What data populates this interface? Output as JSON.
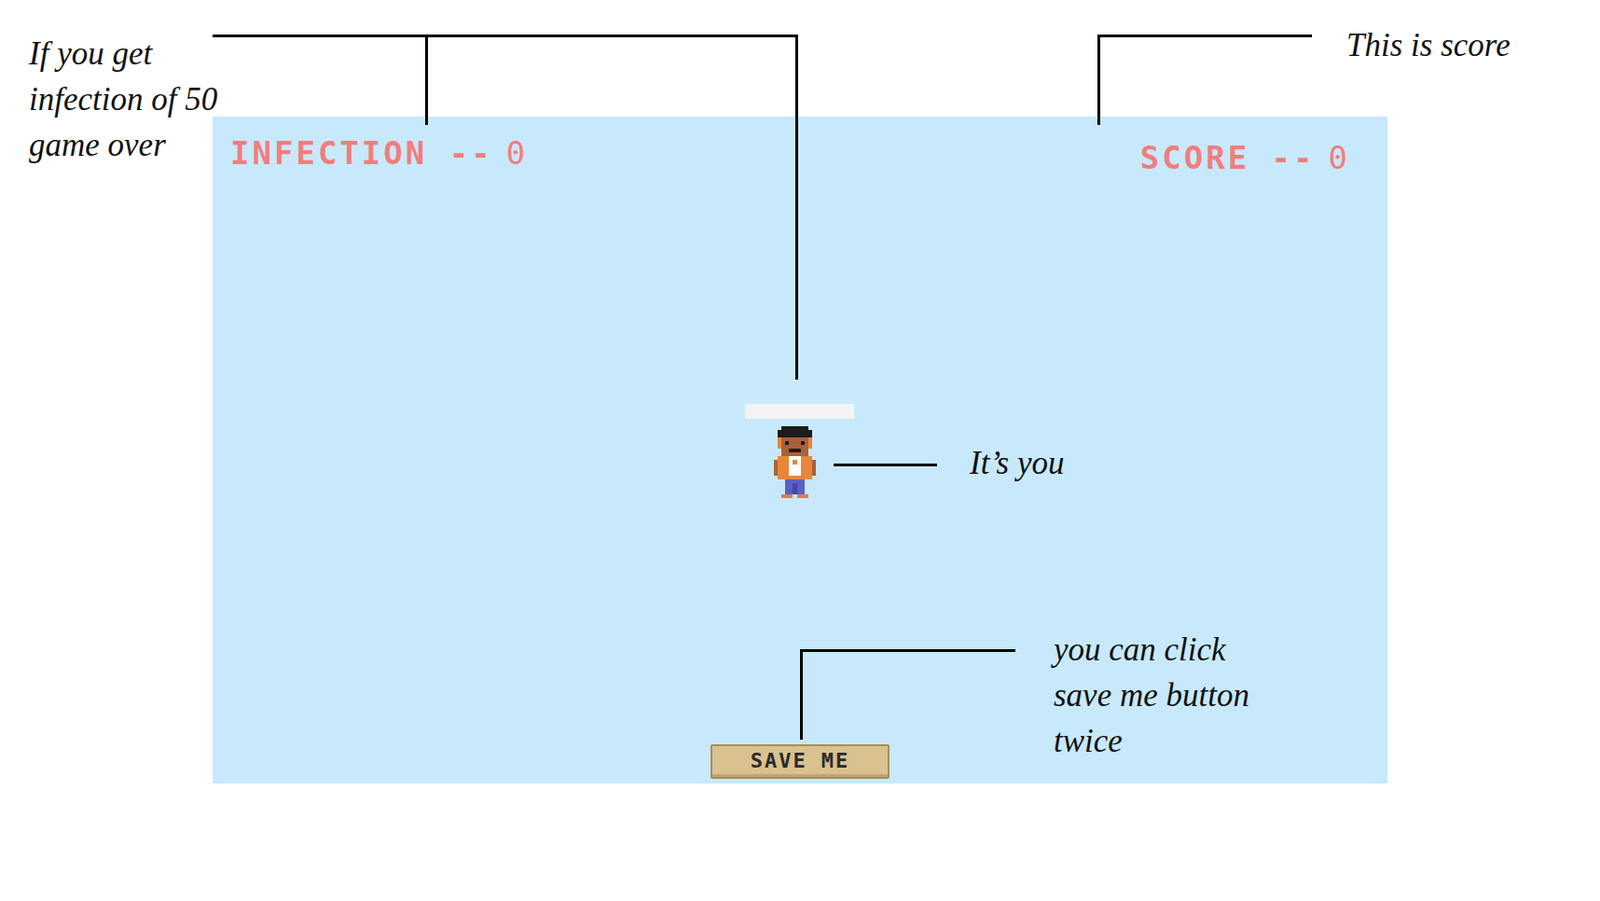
{
  "annotations": {
    "infection_note": [
      "If you get",
      "infection of 50",
      "game over"
    ],
    "score_note": [
      "This is score"
    ],
    "player_note": [
      "It’s you"
    ],
    "button_note": [
      "you can click",
      "save me button",
      "twice"
    ]
  },
  "hud": {
    "infection": {
      "label": "INFECTION --",
      "value": "0"
    },
    "score": {
      "label": "SCORE --",
      "value": "0"
    }
  },
  "player": {
    "health_level": 0
  },
  "save_button": {
    "label": "SAVE ME"
  }
}
